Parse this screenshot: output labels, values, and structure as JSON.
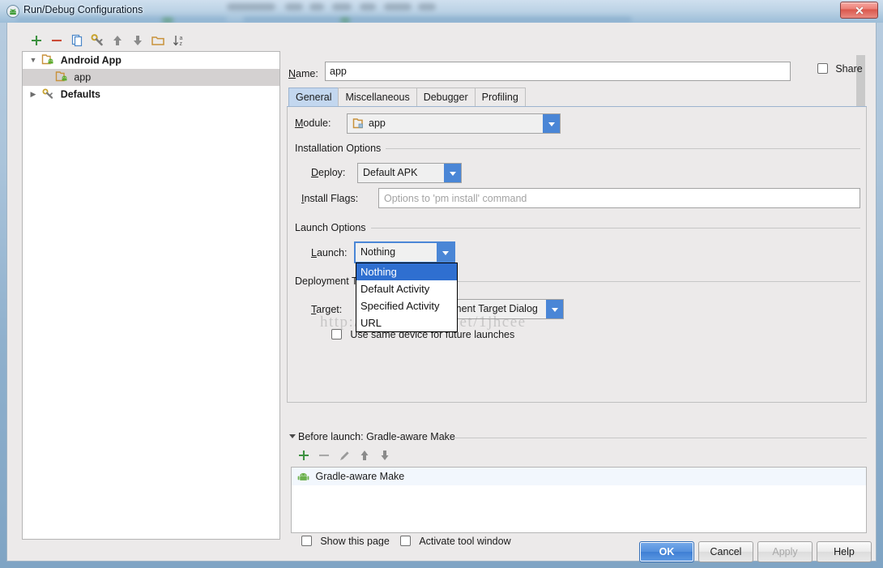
{
  "window": {
    "title": "Run/Debug Configurations",
    "app_icon": "android-studio-icon",
    "close_label": "×"
  },
  "tree_toolbar": {
    "items": [
      {
        "name": "add-configuration-button",
        "icon": "plus-icon",
        "label": "+"
      },
      {
        "name": "remove-configuration-button",
        "icon": "minus-icon",
        "label": "−"
      },
      {
        "name": "copy-configuration-button",
        "icon": "copy-icon",
        "label": "copy"
      },
      {
        "name": "edit-defaults-button",
        "icon": "wrench-icon",
        "label": "defaults"
      },
      {
        "name": "move-up-button",
        "icon": "arrow-up-icon",
        "label": "up"
      },
      {
        "name": "move-down-button",
        "icon": "arrow-down-icon",
        "label": "down"
      },
      {
        "name": "create-folder-button",
        "icon": "folder-icon",
        "label": "folder"
      },
      {
        "name": "sort-alphabetically-button",
        "icon": "sort-az-icon",
        "label": "sort"
      }
    ]
  },
  "tree": {
    "nodes": [
      {
        "label": "Android App",
        "expanded": true,
        "twisty": "▼",
        "icon": "android-app-icon",
        "selected": false,
        "bold": true
      },
      {
        "label": "app",
        "child": true,
        "icon": "android-app-icon",
        "selected": true,
        "bold": false
      },
      {
        "label": "Defaults",
        "expanded": false,
        "twisty": "▶",
        "icon": "wrench-icon",
        "selected": false,
        "bold": true
      }
    ]
  },
  "header": {
    "name_label": "Name:",
    "name_value": "app",
    "share_label": "Share",
    "share_checked": false
  },
  "tabs": [
    {
      "label": "General",
      "active": true
    },
    {
      "label": "Miscellaneous",
      "active": false
    },
    {
      "label": "Debugger",
      "active": false
    },
    {
      "label": "Profiling",
      "active": false
    }
  ],
  "general": {
    "module_label": "Module:",
    "module_value": "app",
    "module_icon": "module-folder-icon",
    "installation_section": "Installation Options",
    "deploy_label": "Deploy:",
    "deploy_value": "Default APK",
    "install_flags_label": "Install Flags:",
    "install_flags_value": "",
    "install_flags_placeholder": "Options to 'pm install' command",
    "launch_section": "Launch Options",
    "launch_label": "Launch:",
    "launch_value": "Nothing",
    "launch_options": [
      "Nothing",
      "Default Activity",
      "Specified Activity",
      "URL"
    ],
    "launch_selected_index": 0,
    "deployment_section": "Deployment Target Options",
    "target_label": "Target:",
    "target_value": "Open Select Deployment Target Dialog",
    "use_same_device_label": "Use same device for future launches",
    "use_same_device_checked": false
  },
  "before_launch": {
    "caption": "Before launch: Gradle-aware Make",
    "toolbar": [
      {
        "name": "before-launch-add-button",
        "icon": "plus-icon"
      },
      {
        "name": "before-launch-remove-button",
        "icon": "minus-icon"
      },
      {
        "name": "before-launch-edit-button",
        "icon": "pencil-icon"
      },
      {
        "name": "before-launch-move-up-button",
        "icon": "arrow-up-icon"
      },
      {
        "name": "before-launch-move-down-button",
        "icon": "arrow-down-icon"
      }
    ],
    "items": [
      {
        "label": "Gradle-aware Make",
        "icon": "android-icon"
      }
    ],
    "show_page_label": "Show this page",
    "show_page_checked": false,
    "activate_tool_window_label": "Activate tool window",
    "activate_tool_window_checked": false
  },
  "buttons": [
    {
      "label": "OK",
      "kind": "primary",
      "name": "ok-button"
    },
    {
      "label": "Cancel",
      "kind": "normal",
      "name": "cancel-button"
    },
    {
      "label": "Apply",
      "kind": "disabled",
      "name": "apply-button"
    },
    {
      "label": "Help",
      "kind": "normal",
      "name": "help-button"
    }
  ],
  "watermark": {
    "text": "http://blog. csdn. net/1jhcee"
  },
  "colors": {
    "accent_blue": "#4a86d6",
    "selection_blue": "#2f6fd0",
    "dialog_bg": "#eceaea",
    "tab_active": "#c3d7ef",
    "tree_selected": "#d4d1d1",
    "green_plus": "#3d9140",
    "red_minus": "#cc4b37"
  }
}
